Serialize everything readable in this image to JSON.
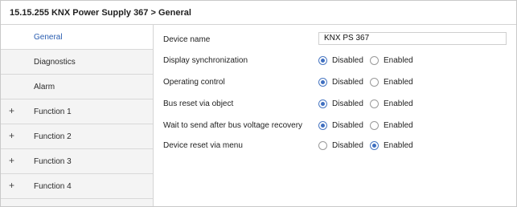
{
  "header": {
    "title": "15.15.255 KNX Power Supply 367 > General"
  },
  "sidebar": {
    "items": [
      {
        "label": "General",
        "expandable": false,
        "selected": true
      },
      {
        "label": "Diagnostics",
        "expandable": false,
        "selected": false
      },
      {
        "label": "Alarm",
        "expandable": false,
        "selected": false
      },
      {
        "label": "Function 1",
        "expandable": true,
        "selected": false
      },
      {
        "label": "Function 2",
        "expandable": true,
        "selected": false
      },
      {
        "label": "Function 3",
        "expandable": true,
        "selected": false
      },
      {
        "label": "Function 4",
        "expandable": true,
        "selected": false
      }
    ],
    "expand_glyph": "+"
  },
  "params": {
    "device_name": {
      "label": "Device name",
      "value": "KNX PS 367"
    },
    "options": {
      "disabled": "Disabled",
      "enabled": "Enabled"
    },
    "rows": [
      {
        "label": "Display synchronization",
        "selected": "disabled"
      },
      {
        "label": "Operating control",
        "selected": "disabled"
      },
      {
        "label": "Bus reset via object",
        "selected": "disabled"
      },
      {
        "label": "Wait to send after bus voltage recovery",
        "selected": "disabled"
      },
      {
        "label": "Device reset via menu",
        "selected": "enabled"
      }
    ]
  },
  "colors": {
    "accent": "#2a5db0",
    "radio_on": "#3f6fc0",
    "sidebar_bg": "#f4f4f4"
  }
}
